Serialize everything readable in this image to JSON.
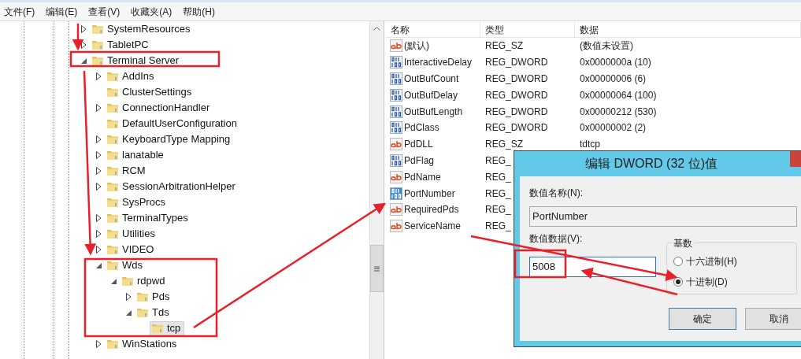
{
  "menu": [
    "文件(F)",
    "编辑(E)",
    "查看(V)",
    "收藏夹(A)",
    "帮助(H)"
  ],
  "tree": [
    {
      "label": "SystemResources",
      "expanded": false,
      "selected": false
    },
    {
      "label": "TabletPC",
      "expanded": false,
      "selected": false
    },
    {
      "label": "Terminal Server",
      "expanded": true,
      "selected": false,
      "children": [
        {
          "label": "AddIns",
          "expanded": false,
          "selected": false
        },
        {
          "label": "ClusterSettings",
          "selected": false
        },
        {
          "label": "ConnectionHandler",
          "expanded": false,
          "selected": false
        },
        {
          "label": "DefaultUserConfiguration",
          "selected": false
        },
        {
          "label": "KeyboardType Mapping",
          "expanded": false,
          "selected": false
        },
        {
          "label": "lanatable",
          "expanded": false,
          "selected": false
        },
        {
          "label": "RCM",
          "expanded": false,
          "selected": false
        },
        {
          "label": "SessionArbitrationHelper",
          "expanded": false,
          "selected": false
        },
        {
          "label": "SysProcs",
          "selected": false
        },
        {
          "label": "TerminalTypes",
          "expanded": false,
          "selected": false
        },
        {
          "label": "Utilities",
          "expanded": false,
          "selected": false
        },
        {
          "label": "VIDEO",
          "expanded": false,
          "selected": false
        },
        {
          "label": "Wds",
          "expanded": true,
          "selected": false,
          "children": [
            {
              "label": "rdpwd",
              "expanded": true,
              "selected": false,
              "children": [
                {
                  "label": "Pds",
                  "expanded": false,
                  "selected": false
                },
                {
                  "label": "Tds",
                  "expanded": true,
                  "selected": false,
                  "children": [
                    {
                      "label": "tcp",
                      "selected": true
                    }
                  ]
                }
              ]
            }
          ]
        },
        {
          "label": "WinStations",
          "expanded": false,
          "selected": false
        }
      ]
    }
  ],
  "table": {
    "columns": [
      "名称",
      "类型",
      "数据"
    ],
    "rows": [
      {
        "kind": "string",
        "selected": false,
        "name": "(默认)",
        "type": "REG_SZ",
        "data": "(数值未设置)"
      },
      {
        "kind": "binary",
        "selected": false,
        "name": "InteractiveDelay",
        "type": "REG_DWORD",
        "data": "0x0000000a (10)"
      },
      {
        "kind": "binary",
        "selected": false,
        "name": "OutBufCount",
        "type": "REG_DWORD",
        "data": "0x00000006 (6)"
      },
      {
        "kind": "binary",
        "selected": false,
        "name": "OutBufDelay",
        "type": "REG_DWORD",
        "data": "0x00000064 (100)"
      },
      {
        "kind": "binary",
        "selected": false,
        "name": "OutBufLength",
        "type": "REG_DWORD",
        "data": "0x00000212 (530)"
      },
      {
        "kind": "binary",
        "selected": false,
        "name": "PdClass",
        "type": "REG_DWORD",
        "data": "0x00000002 (2)"
      },
      {
        "kind": "string",
        "selected": false,
        "name": "PdDLL",
        "type": "REG_SZ",
        "data": "tdtcp"
      },
      {
        "kind": "binary",
        "selected": false,
        "name": "PdFlag",
        "type": "REG_"
      },
      {
        "kind": "string",
        "selected": false,
        "name": "PdName",
        "type": "REG_"
      },
      {
        "kind": "binary",
        "selected": true,
        "name": "PortNumber",
        "type": "REG_"
      },
      {
        "kind": "string",
        "selected": false,
        "name": "RequiredPds",
        "type": "REG_"
      },
      {
        "kind": "string",
        "selected": false,
        "name": "ServiceName",
        "type": "REG_"
      }
    ]
  },
  "dialog": {
    "title": "编辑 DWORD (32 位)值",
    "name_label": "数值名称(N):",
    "name_value": "PortNumber",
    "data_label": "数值数据(V):",
    "data_value": "5008",
    "base_label": "基数",
    "radios": [
      {
        "label": "十六进制(H)",
        "selected": false
      },
      {
        "label": "十进制(D)",
        "selected": true
      }
    ],
    "buttons": [
      {
        "label": "确定",
        "default": true
      },
      {
        "label": "取消",
        "default": false
      }
    ]
  }
}
